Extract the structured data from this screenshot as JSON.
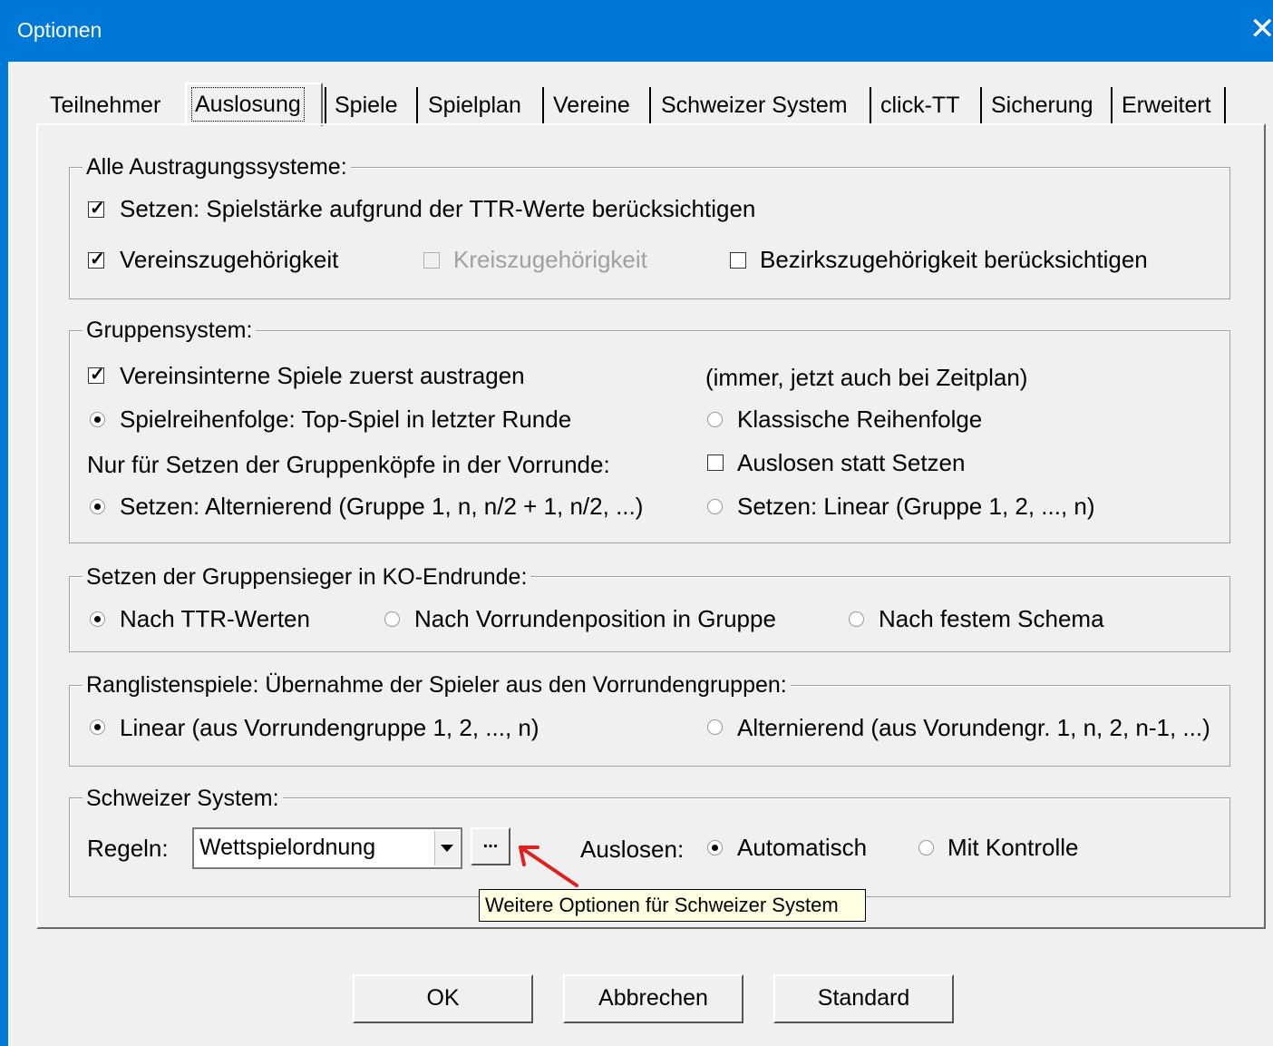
{
  "window": {
    "title": "Optionen",
    "close_icon": "close-icon"
  },
  "tabs": [
    "Teilnehmer",
    "Auslosung",
    "Spiele",
    "Spielplan",
    "Vereine",
    "Schweizer System",
    "click-TT",
    "Sicherung",
    "Erweitert"
  ],
  "active_tab": "Auslosung",
  "groups": {
    "alle": {
      "legend": "Alle Austragungssysteme:",
      "setzen_ttr": {
        "label": "Setzen: Spielstärke aufgrund der TTR-Werte berücksichtigen",
        "checked": true
      },
      "vereinszugehoerigkeit": {
        "label": "Vereinszugehörigkeit",
        "checked": true
      },
      "kreiszugehoerigkeit": {
        "label": "Kreiszugehörigkeit",
        "checked": false,
        "disabled": true
      },
      "bezirkszugehoerigkeit": {
        "label": "Bezirkszugehörigkeit berücksichtigen",
        "checked": false
      }
    },
    "gruppensystem": {
      "legend": "Gruppensystem:",
      "vereinsinterne": {
        "label": "Vereinsinterne Spiele zuerst austragen",
        "checked": true
      },
      "note": "(immer, jetzt auch bei Zeitplan)",
      "top_spiel": {
        "label": "Spielreihenfolge: Top-Spiel in letzter Runde",
        "selected": true
      },
      "klassische": {
        "label": "Klassische Reihenfolge",
        "selected": false
      },
      "nur_fuer": "Nur für Setzen der Gruppenköpfe in der Vorrunde:",
      "auslosen_statt": {
        "label": "Auslosen statt Setzen",
        "checked": false
      },
      "alternierend": {
        "label": "Setzen: Alternierend (Gruppe 1, n, n/2 + 1, n/2, ...)",
        "selected": true
      },
      "linear": {
        "label": "Setzen: Linear (Gruppe 1, 2, ..., n)",
        "selected": false
      }
    },
    "ko": {
      "legend": "Setzen der Gruppensieger in KO-Endrunde:",
      "ttr": {
        "label": "Nach TTR-Werten",
        "selected": true
      },
      "vorrunde": {
        "label": "Nach Vorrundenposition in Gruppe",
        "selected": false
      },
      "schema": {
        "label": "Nach festem Schema",
        "selected": false
      }
    },
    "rangliste": {
      "legend": "Ranglistenspiele: Übernahme der Spieler aus den Vorrundengruppen:",
      "linear": {
        "label": "Linear (aus Vorrundengruppe 1, 2, ..., n)",
        "selected": true
      },
      "alternierend": {
        "label": "Alternierend (aus Vorundengr. 1, n, 2, n-1, ...)",
        "selected": false
      }
    },
    "schweizer": {
      "legend": "Schweizer System:",
      "regeln_label": "Regeln:",
      "regeln_value": "Wettspielordnung",
      "ellipsis": "...",
      "auslosen_label": "Auslosen:",
      "automatisch": {
        "label": "Automatisch",
        "selected": true
      },
      "kontrolle": {
        "label": "Mit Kontrolle",
        "selected": false
      }
    }
  },
  "tooltip": "Weitere Optionen für Schweizer System",
  "buttons": {
    "ok": "OK",
    "cancel": "Abbrechen",
    "default": "Standard"
  },
  "colors": {
    "titlebar": "#0078d7",
    "dialog_bg": "#f0f0f0",
    "tooltip_bg": "#ffffe1",
    "annotation_arrow": "#e02020"
  }
}
